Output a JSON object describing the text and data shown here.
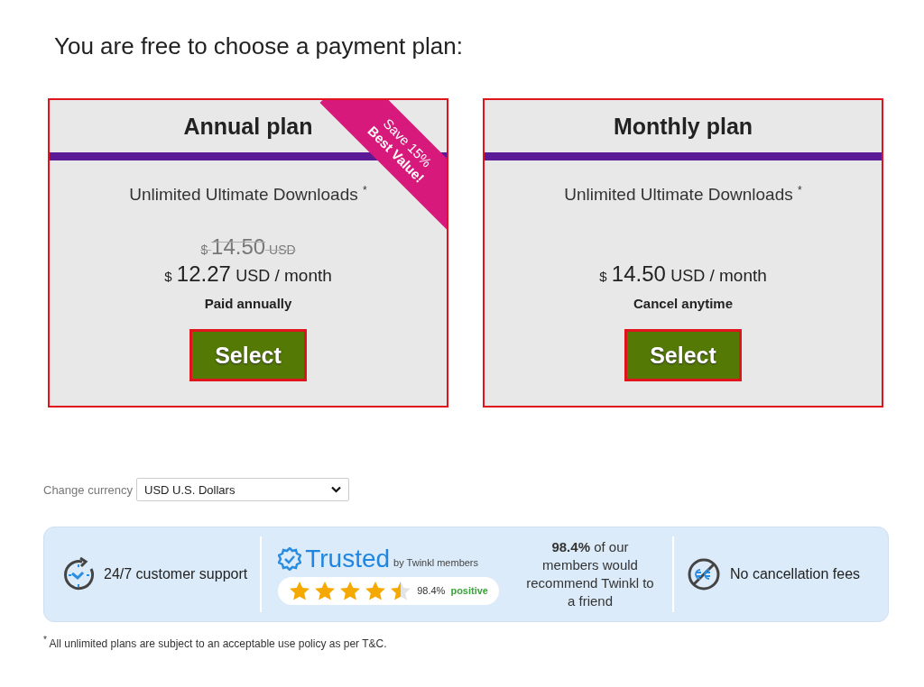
{
  "heading": "You are free to choose a payment plan:",
  "plans": [
    {
      "title": "Annual plan",
      "ribbon": [
        "Save 15%",
        "Best Value!"
      ],
      "feature": "Unlimited Ultimate Downloads",
      "feature_mark": "*",
      "old_price": {
        "currency": "$",
        "amount": "14.50",
        "unit": "USD"
      },
      "price": {
        "currency": "$",
        "amount": "12.27",
        "unit": "USD",
        "period": "/ month"
      },
      "note": "Paid annually",
      "button": "Select"
    },
    {
      "title": "Monthly plan",
      "feature": "Unlimited Ultimate Downloads",
      "feature_mark": "*",
      "price": {
        "currency": "$",
        "amount": "14.50",
        "unit": "USD",
        "period": "/ month"
      },
      "note": "Cancel anytime",
      "button": "Select"
    }
  ],
  "currency": {
    "label": "Change currency",
    "value": "USD U.S. Dollars"
  },
  "trust_bar": {
    "support": "24/7 customer support",
    "trusted": "Trusted",
    "trusted_by": "by Twinkl members",
    "stars": 4.5,
    "rating": "98.4%",
    "rating_word": "positive",
    "recommend": "**98.4%** of our members would recommend Twinkl to a friend",
    "no_fees": "No cancellation fees"
  },
  "footnote": "$^{*}$ All unlimited plans are subject to an acceptable use policy as per T&C."
}
